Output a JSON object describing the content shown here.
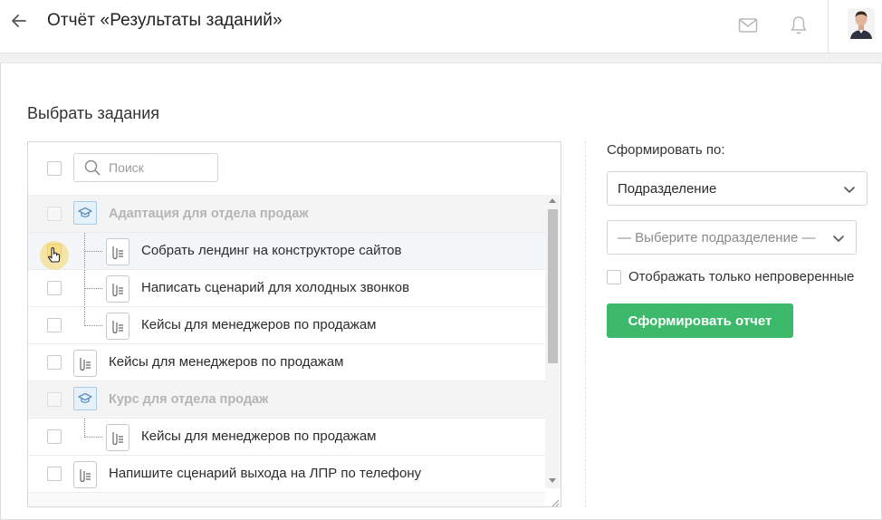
{
  "header": {
    "title": "Отчёт «Результаты заданий»",
    "back_icon": "arrow-left-icon",
    "icons": [
      "envelope-icon",
      "bell-icon"
    ]
  },
  "main": {
    "section_title": "Выбрать задания",
    "search": {
      "placeholder": "Поиск"
    },
    "tasks": [
      {
        "type": "group",
        "label": "Адаптация для отдела продаж"
      },
      {
        "type": "child",
        "label": "Собрать лендинг на конструкторе сайтов"
      },
      {
        "type": "child",
        "label": "Написать сценарий для холодных звонков"
      },
      {
        "type": "child",
        "label": "Кейсы для менеджеров по продажам"
      },
      {
        "type": "task",
        "label": "Кейсы для менеджеров по продажам"
      },
      {
        "type": "group",
        "label": "Курс для отдела продаж"
      },
      {
        "type": "child",
        "label": "Кейсы для менеджеров по продажам"
      },
      {
        "type": "task",
        "label": "Напишите сценарий выхода на ЛПР по телефону"
      }
    ]
  },
  "sidebar": {
    "label": "Сформировать по:",
    "group_by_select": {
      "value": "Подразделение"
    },
    "department_select": {
      "placeholder": "— Выберите подразделение —"
    },
    "only_unchecked_label": "Отображать только непроверенные",
    "submit_label": "Сформировать отчет"
  },
  "colors": {
    "accent_green": "#3cb96a",
    "group_icon_bg": "#e7f1f9",
    "group_icon_border": "#a8cbe6"
  }
}
